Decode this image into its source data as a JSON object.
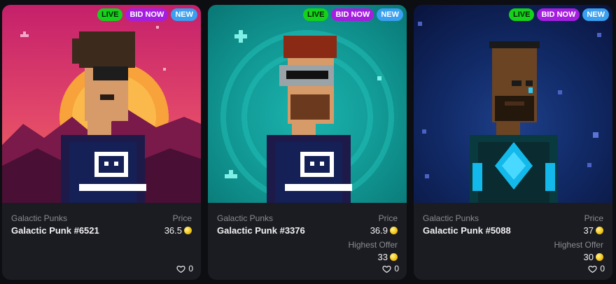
{
  "cards": [
    {
      "badges": [
        "LIVE",
        "BID NOW",
        "NEW"
      ],
      "collection": "Galactic Punks",
      "name": "Galactic Punk #6521",
      "price_label": "Price",
      "price": "36.5",
      "highest_offer_label": "",
      "highest_offer": "",
      "likes": "0"
    },
    {
      "badges": [
        "LIVE",
        "BID NOW",
        "NEW"
      ],
      "collection": "Galactic Punks",
      "name": "Galactic Punk #3376",
      "price_label": "Price",
      "price": "36.9",
      "highest_offer_label": "Highest Offer",
      "highest_offer": "33",
      "likes": "0"
    },
    {
      "badges": [
        "LIVE",
        "BID NOW",
        "NEW"
      ],
      "collection": "Galactic Punks",
      "name": "Galactic Punk #5088",
      "price_label": "Price",
      "price": "37",
      "highest_offer_label": "Highest Offer",
      "highest_offer": "30",
      "likes": "0"
    }
  ],
  "colors": {
    "live": "#16d11a",
    "bid_now": "#a51ee0",
    "new": "#3aa0f0",
    "card_bg": "#1b1c21",
    "coin": "#f4c716"
  },
  "icons": {
    "currency": "gold-coin-icon",
    "like": "heart-icon"
  }
}
